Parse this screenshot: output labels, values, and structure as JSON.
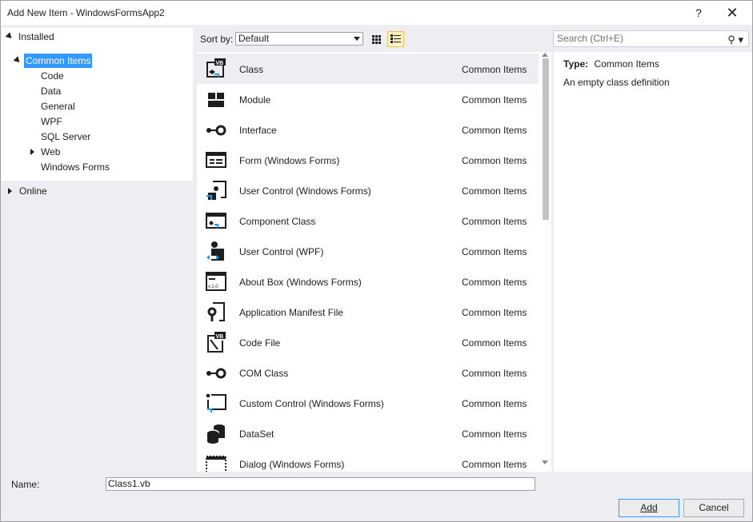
{
  "window": {
    "title": "Add New Item - WindowsFormsApp2",
    "help": "?",
    "close": "✕"
  },
  "tree": {
    "installed": "Installed",
    "common_items": "Common Items",
    "children": [
      "Code",
      "Data",
      "General",
      "WPF",
      "SQL Server",
      "Web",
      "Windows Forms"
    ],
    "online": "Online"
  },
  "toolbar": {
    "sort_label": "Sort by:",
    "sort_value": "Default",
    "search_placeholder": "Search (Ctrl+E)"
  },
  "templates": [
    {
      "name": "Class",
      "category": "Common Items",
      "icon": "vb-class-icon"
    },
    {
      "name": "Module",
      "category": "Common Items",
      "icon": "module-icon"
    },
    {
      "name": "Interface",
      "category": "Common Items",
      "icon": "interface-icon"
    },
    {
      "name": "Form (Windows Forms)",
      "category": "Common Items",
      "icon": "form-icon"
    },
    {
      "name": "User Control (Windows Forms)",
      "category": "Common Items",
      "icon": "user-control-icon"
    },
    {
      "name": "Component Class",
      "category": "Common Items",
      "icon": "component-icon"
    },
    {
      "name": "User Control (WPF)",
      "category": "Common Items",
      "icon": "wpf-user-control-icon"
    },
    {
      "name": "About Box (Windows Forms)",
      "category": "Common Items",
      "icon": "about-box-icon"
    },
    {
      "name": "Application Manifest File",
      "category": "Common Items",
      "icon": "manifest-icon"
    },
    {
      "name": "Code File",
      "category": "Common Items",
      "icon": "vb-code-file-icon"
    },
    {
      "name": "COM Class",
      "category": "Common Items",
      "icon": "com-class-icon"
    },
    {
      "name": "Custom Control (Windows Forms)",
      "category": "Common Items",
      "icon": "custom-control-icon"
    },
    {
      "name": "DataSet",
      "category": "Common Items",
      "icon": "dataset-icon"
    },
    {
      "name": "Dialog (Windows Forms)",
      "category": "Common Items",
      "icon": "dialog-icon"
    }
  ],
  "details": {
    "type_label": "Type:",
    "type_value": "Common Items",
    "description": "An empty class definition"
  },
  "footer": {
    "name_label": "Name:",
    "name_value": "Class1.vb",
    "add": "Add",
    "cancel": "Cancel"
  },
  "colors": {
    "selection": "#3399ff",
    "dark_icon": "#1e1e1e",
    "accent": "#1ba1e2"
  }
}
